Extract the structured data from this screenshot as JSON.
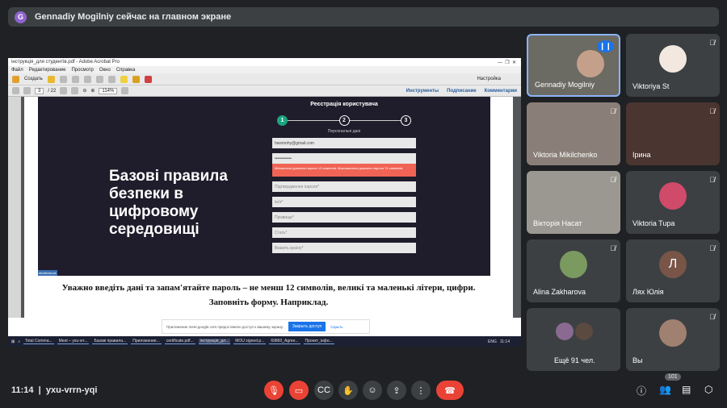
{
  "banner": {
    "avatar": "G",
    "text": "Gennadiy Mogilniy сейчас на главном экране"
  },
  "acrobat": {
    "title": "інструкція_для студентів.pdf - Adobe Acrobat Pro",
    "menu": [
      "Файл",
      "Редактирование",
      "Просмотр",
      "Окно",
      "Справка"
    ],
    "create": "Создать",
    "settings": "Настройка",
    "page": "3",
    "pages": "/ 22",
    "zoom": "114%",
    "links": [
      "Инструменты",
      "Подписание",
      "Комментарии"
    ]
  },
  "slide": {
    "heading": "Базові правила безпеки в цифровому середовищі",
    "form_title": "Реєстрація користувача",
    "steps": [
      "1",
      "2",
      "3"
    ],
    "step_label": "Персональні дані",
    "email": "hwsmohy@gmail.com",
    "password": "••••••••••••",
    "error": "Мінімальна довжина пароля 12 символів. Максимальна довжина пароля 74 символів.",
    "fields": [
      "Підтвердження пароля*",
      "Ім'я*",
      "Прізвище*",
      "Стать*",
      "Вкажіть країну*"
    ],
    "tag": "shutterstock"
  },
  "caption": [
    "Уважно введіть дані та запам'ятайте пароль – не менш 12 символів, великі та маленькі літери, цифри.",
    "Заповніть форму. Наприклад."
  ],
  "notice": {
    "text": "Приложение meet.google.com предоставлен доступ к вашему экрану.",
    "stop": "Закрыть доступ",
    "hide": "Скрыть"
  },
  "taskbar": {
    "items": [
      "Total Comma...",
      "Meet – yxu-vrr...",
      "Базові правила...",
      "Приложение...",
      "certificate.pdf...",
      "інструкція_дл...",
      "MOU signed.p...",
      "69860_Agree...",
      "Проект_інфо..."
    ],
    "lang": "ENG",
    "time": "11:14"
  },
  "participants": [
    {
      "name": "Gennadiy Mogilniy",
      "active": true
    },
    {
      "name": "Viktoriya St"
    },
    {
      "name": "Viktoria Mikilchenko"
    },
    {
      "name": "Ірина"
    },
    {
      "name": "Вікторія Насат"
    },
    {
      "name": "Viktoria Tupa"
    },
    {
      "name": "Alina Zakharova"
    },
    {
      "name": "Лях Юлія",
      "initial": "Л"
    },
    {
      "name": "Ещё 91 чел."
    },
    {
      "name": "Вы"
    }
  ],
  "bottom": {
    "time": "11:14",
    "separator": "|",
    "code": "yxu-vrrn-yqi",
    "count": "101"
  },
  "colors": {
    "accent": "#1a73e8",
    "end": "#ea4335"
  }
}
